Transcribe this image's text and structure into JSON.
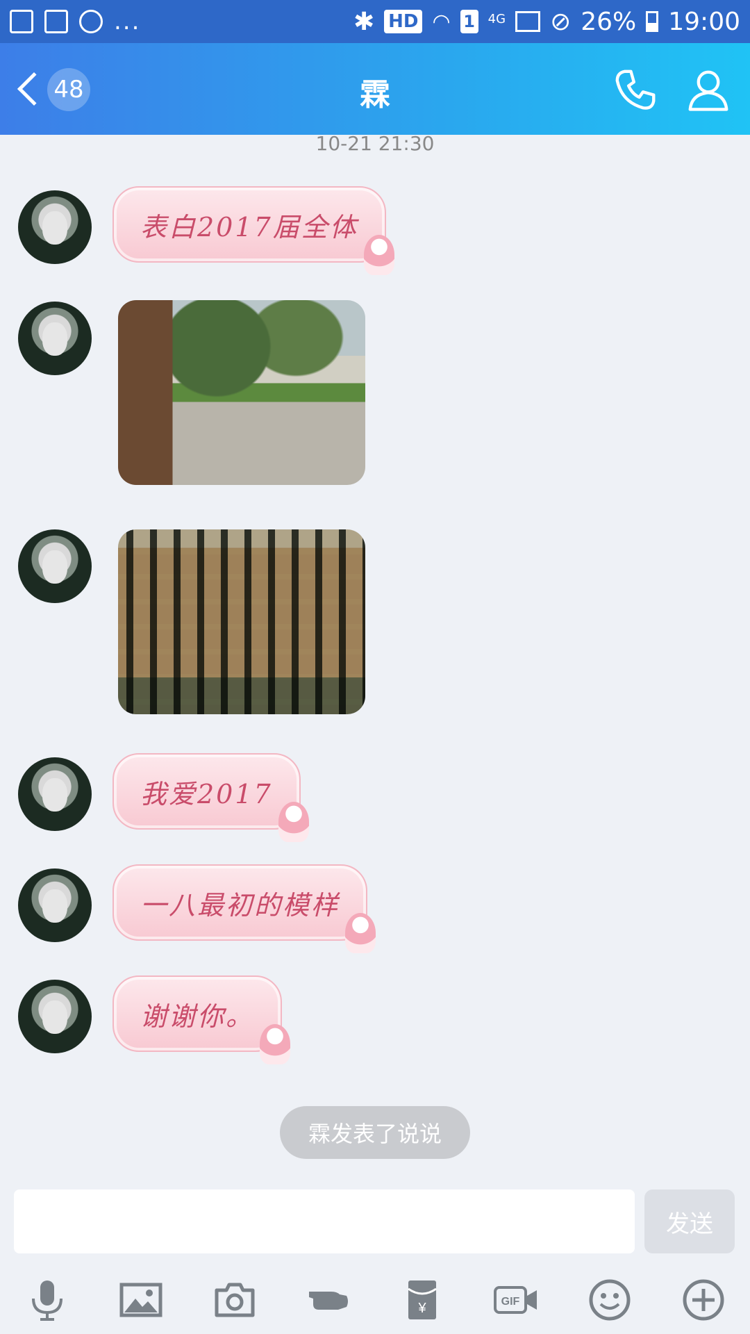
{
  "status_bar": {
    "dots": "...",
    "hd": "HD",
    "sim": "1",
    "net": "4G",
    "battery": "26%",
    "time": "19:00"
  },
  "header": {
    "unread_count": "48",
    "title": "霖"
  },
  "timestamp": "10-21 21:30",
  "messages": [
    {
      "type": "text",
      "text": "表白2017届全体"
    },
    {
      "type": "image"
    },
    {
      "type": "image"
    },
    {
      "type": "text",
      "text": "我爱2017"
    },
    {
      "type": "text",
      "text": "一八最初的模样"
    },
    {
      "type": "text",
      "text": "谢谢你。"
    }
  ],
  "system_notice": "霖发表了说说",
  "input": {
    "send_label": "发送"
  },
  "toolbar": [
    "mic-icon",
    "image-icon",
    "camera-icon",
    "poke-icon",
    "red-packet-icon",
    "gif-icon",
    "emoji-icon",
    "plus-icon"
  ],
  "colors": {
    "header_start": "#3d7ee8",
    "header_end": "#20c3f5",
    "bubble_text": "#c94c6a",
    "bubble_bg": "#f8c9d2"
  }
}
